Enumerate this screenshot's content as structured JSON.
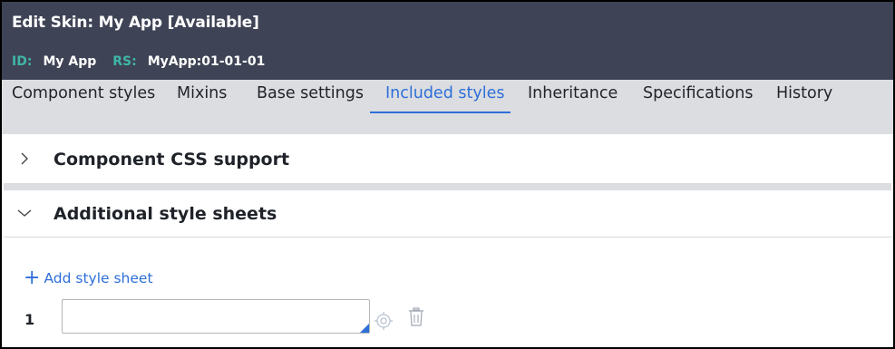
{
  "header": {
    "title": "Edit Skin: My App [Available]",
    "id_label": "ID:",
    "id_value": "My App",
    "rs_label": "RS:",
    "rs_value": "MyApp:01-01-01"
  },
  "tabs": [
    {
      "label": "Component styles"
    },
    {
      "label": "Mixins"
    },
    {
      "label": "Base settings"
    },
    {
      "label": "Included styles",
      "active": true
    },
    {
      "label": "Inheritance"
    },
    {
      "label": "Specifications"
    },
    {
      "label": "History"
    }
  ],
  "sections": {
    "component_css": {
      "title": "Component CSS support",
      "expanded": false
    },
    "additional_sheets": {
      "title": "Additional style sheets",
      "expanded": true
    }
  },
  "additional": {
    "add_label": "Add style sheet",
    "rows": [
      {
        "index": "1",
        "value": "",
        "placeholder": ""
      }
    ]
  },
  "icons": {
    "expand": "chevron-right-icon",
    "collapse": "chevron-down-icon",
    "add": "plus-icon",
    "picker": "target-icon",
    "delete": "trash-icon"
  },
  "colors": {
    "header_bg": "#3e4355",
    "accent": "#2e6fd8",
    "meta_label": "#3fb6a8",
    "tabbar_bg": "#dcdde1"
  }
}
